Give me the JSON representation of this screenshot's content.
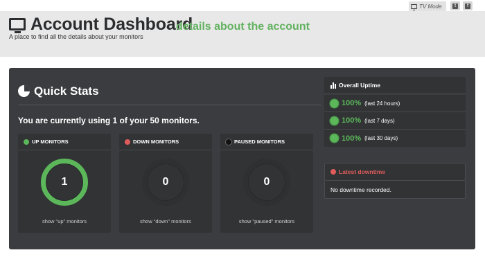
{
  "topbar": {
    "tv_mode_label": "TV Mode",
    "social": [
      {
        "icon": "twitter-icon",
        "glyph": "t"
      },
      {
        "icon": "facebook-icon",
        "glyph": "f"
      }
    ]
  },
  "header": {
    "title": "Account Dashboard",
    "subtitle": "details about the account",
    "description": "A place to find all the details about your monitors"
  },
  "quick_stats": {
    "title": "Quick Stats",
    "message": "You are currently using 1 of your 50 monitors.",
    "cards": [
      {
        "label": "UP MONITORS",
        "value": "1",
        "link": "show \"up\" monitors",
        "status_color": "#5cb75a"
      },
      {
        "label": "DOWN MONITORS",
        "value": "0",
        "link": "show \"down\" monitors",
        "status_color": "#e05c5a"
      },
      {
        "label": "PAUSED MONITORS",
        "value": "0",
        "link": "show \"paused\" monitors",
        "status_color": "#111111"
      }
    ]
  },
  "uptime": {
    "title": "Overall Uptime",
    "rows": [
      {
        "percent": "100%",
        "period": "(last 24 hours)"
      },
      {
        "percent": "100%",
        "period": "(last 7 days)"
      },
      {
        "percent": "100%",
        "period": "(last 30 days)"
      }
    ]
  },
  "downtime": {
    "title": "Latest downtime",
    "message": "No downtime recorded."
  },
  "colors": {
    "accent_green": "#5cb75a",
    "accent_red": "#e05c5a",
    "panel_bg": "#3a3c3f"
  }
}
